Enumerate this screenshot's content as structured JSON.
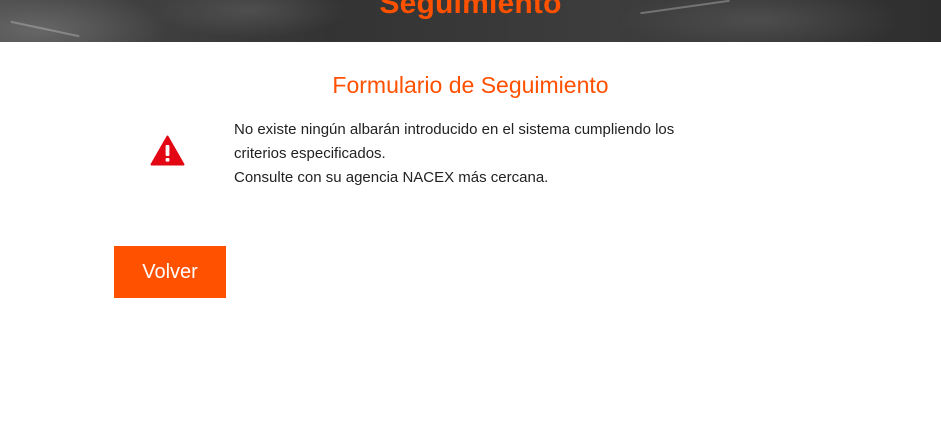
{
  "header": {
    "title": "Seguimiento"
  },
  "form": {
    "title": "Formulario de Seguimiento",
    "message_line1": "No existe ningún albarán introducido en el sistema cumpliendo los",
    "message_line2": "criterios especificados.",
    "message_line3": "Consulte con su agencia NACEX más cercana.",
    "icon": "warning-triangle-icon",
    "back_button_label": "Volver"
  },
  "colors": {
    "accent": "#ff5100",
    "warning": "#e30613",
    "header_bg": "#3b3b3b",
    "text": "#222222"
  }
}
